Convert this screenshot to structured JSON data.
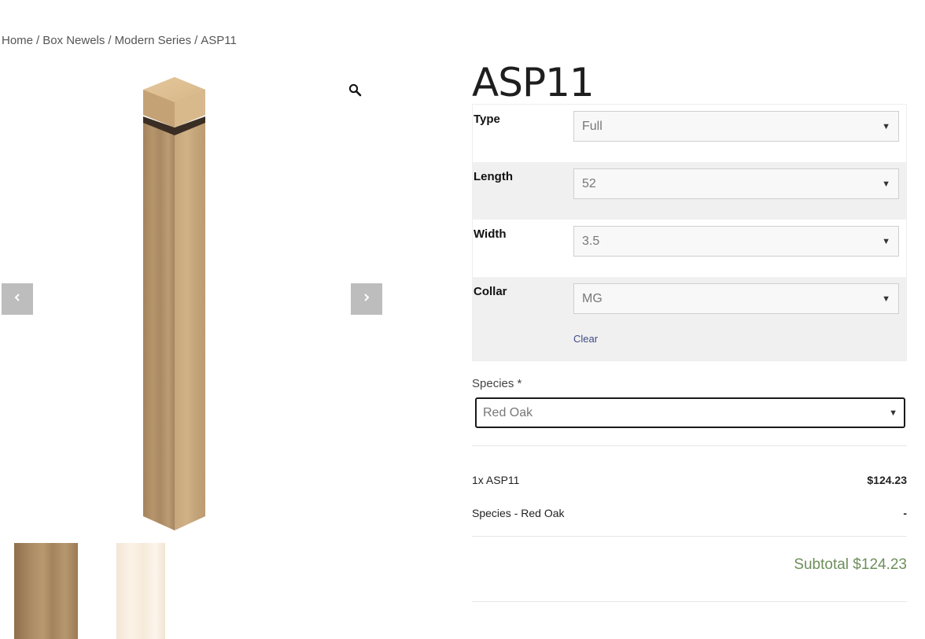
{
  "breadcrumb": {
    "items": [
      "Home",
      "Box Newels",
      "Modern Series",
      "ASP11"
    ],
    "separator": "/"
  },
  "gallery": {
    "zoom_icon": "magnifier-icon",
    "prev_icon": "chevron-left-icon",
    "next_icon": "chevron-right-icon"
  },
  "product": {
    "title": "ASP11"
  },
  "variations": {
    "type": {
      "label": "Type",
      "value": "Full"
    },
    "length": {
      "label": "Length",
      "value": "52"
    },
    "width": {
      "label": "Width",
      "value": "3.5"
    },
    "collar": {
      "label": "Collar",
      "value": "MG"
    },
    "clear_label": "Clear"
  },
  "species": {
    "label": "Species *",
    "value": "Red Oak"
  },
  "line_items": [
    {
      "name": "1x ASP11",
      "price": "$124.23"
    },
    {
      "name": "Species - Red Oak",
      "price": "-"
    }
  ],
  "subtotal": "Subtotal $124.23",
  "colors": {
    "subtotal_green": "#6d8f5b",
    "clear_link": "#3f4a86",
    "nav_arrow_bg": "#bdbdbd",
    "row_alt_bg": "#f0f0f0"
  }
}
